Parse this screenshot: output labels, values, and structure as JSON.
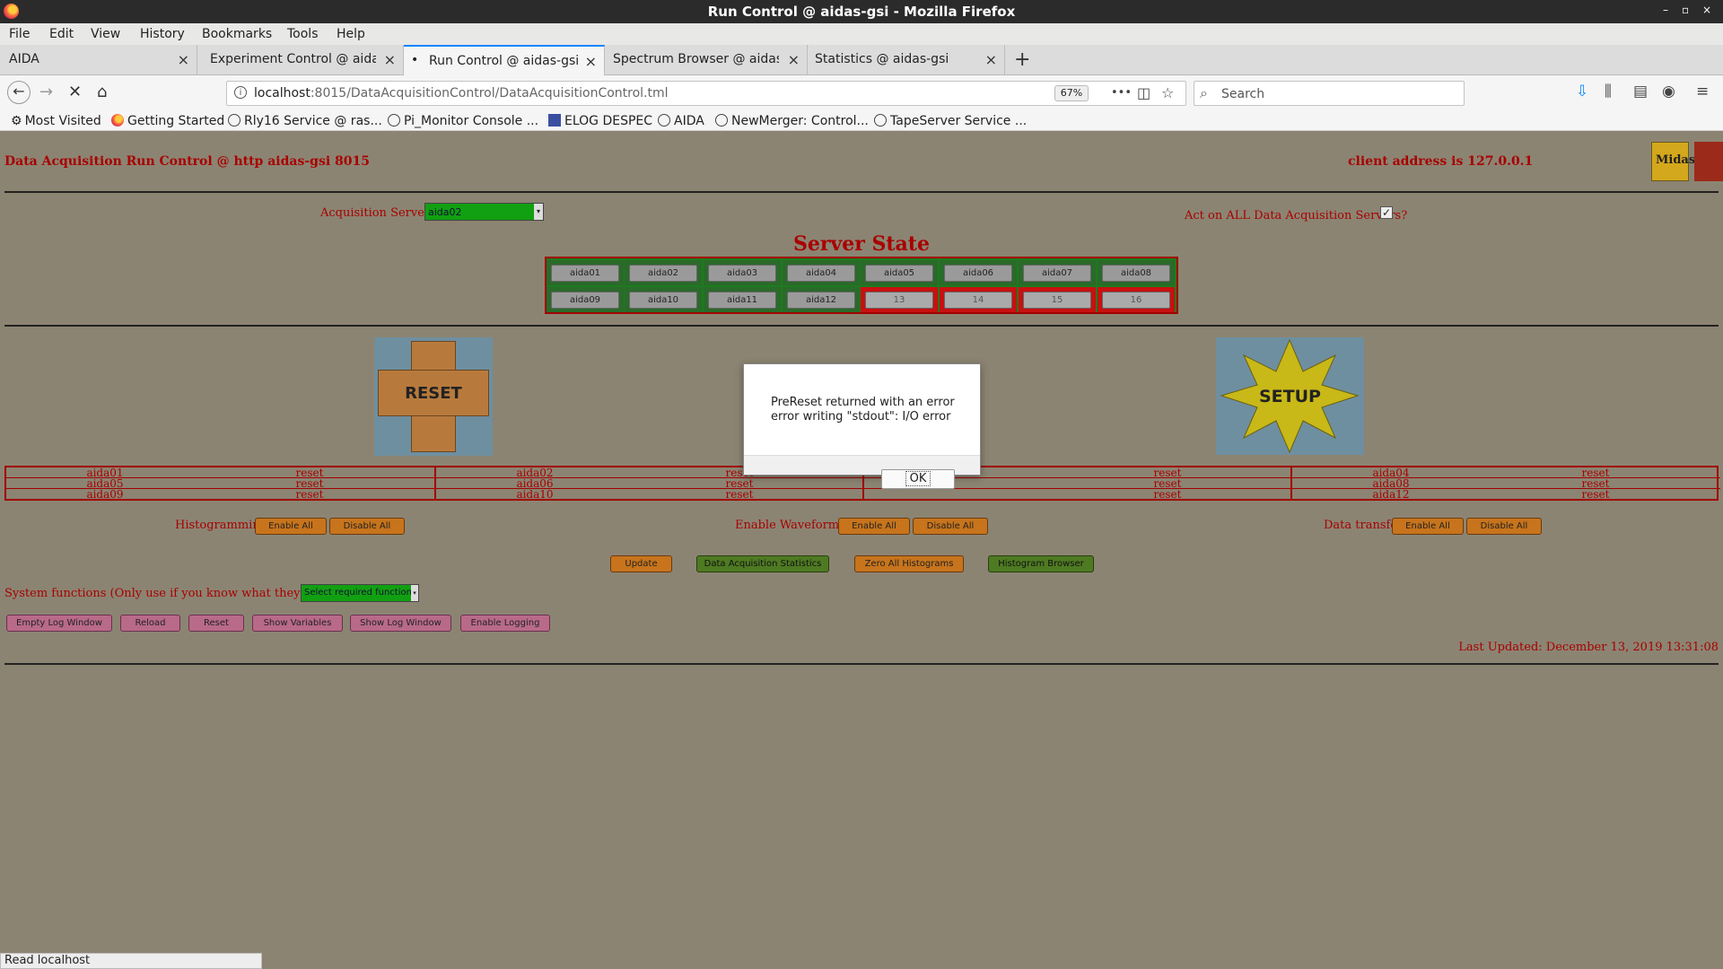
{
  "window": {
    "title": "Run Control @ aidas-gsi - Mozilla Firefox",
    "controls": [
      "–",
      "▫",
      "×"
    ]
  },
  "menubar": [
    "File",
    "Edit",
    "View",
    "History",
    "Bookmarks",
    "Tools",
    "Help"
  ],
  "tabs": [
    {
      "label": "AIDA",
      "active": false
    },
    {
      "label": "Experiment Control @ aidas-",
      "active": false
    },
    {
      "label": "Run Control @ aidas-gsi",
      "active": true
    },
    {
      "label": "Spectrum Browser @ aidas-g",
      "active": false
    },
    {
      "label": "Statistics @ aidas-gsi",
      "active": false
    }
  ],
  "navbar": {
    "url_host": "localhost",
    "url_rest": ":8015/DataAcquisitionControl/DataAcquisitionControl.tml",
    "zoom": "67%",
    "more": "•••",
    "search_placeholder": "Search"
  },
  "bookmarks": [
    {
      "label": "Most Visited",
      "icon": "gear-icon"
    },
    {
      "label": "Getting Started",
      "icon": "firefox-icon"
    },
    {
      "label": "Rly16 Service @ ras...",
      "icon": "globe-icon"
    },
    {
      "label": "Pi_Monitor Console ...",
      "icon": "globe-icon"
    },
    {
      "label": "ELOG DESPEC",
      "icon": "elog-icon"
    },
    {
      "label": "AIDA",
      "icon": "globe-icon"
    },
    {
      "label": "NewMerger: Control...",
      "icon": "globe-icon"
    },
    {
      "label": "TapeServer Service ...",
      "icon": "globe-icon"
    }
  ],
  "page": {
    "heading": "Data Acquisition Run Control @ http aidas-gsi 8015",
    "client_address": "client address is 127.0.0.1",
    "logo_text": "Midas",
    "acquisition_servers_label": "Acquisition Servers",
    "acquisition_server_selected": "aida02",
    "act_on_all_label": "Act on ALL Data Acquisition Servers?",
    "act_on_all_checked": true,
    "server_state_title": "Server State",
    "servers": [
      {
        "label": "aida01",
        "state": "ok"
      },
      {
        "label": "aida02",
        "state": "ok"
      },
      {
        "label": "aida03",
        "state": "ok"
      },
      {
        "label": "aida04",
        "state": "ok"
      },
      {
        "label": "aida05",
        "state": "ok"
      },
      {
        "label": "aida06",
        "state": "ok"
      },
      {
        "label": "aida07",
        "state": "ok"
      },
      {
        "label": "aida08",
        "state": "ok"
      },
      {
        "label": "aida09",
        "state": "ok"
      },
      {
        "label": "aida10",
        "state": "ok"
      },
      {
        "label": "aida11",
        "state": "ok"
      },
      {
        "label": "aida12",
        "state": "ok"
      },
      {
        "label": "13",
        "state": "bad"
      },
      {
        "label": "14",
        "state": "bad"
      },
      {
        "label": "15",
        "state": "bad"
      },
      {
        "label": "16",
        "state": "bad"
      }
    ],
    "reset_button_label": "RESET",
    "setup_button_label": "SETUP",
    "reset_table": [
      [
        {
          "name": "aida01",
          "status": "reset"
        },
        {
          "name": "aida05",
          "status": "reset"
        },
        {
          "name": "aida09",
          "status": "reset"
        }
      ],
      [
        {
          "name": "aida02",
          "status": "reset"
        },
        {
          "name": "aida06",
          "status": "reset"
        },
        {
          "name": "aida10",
          "status": "reset"
        }
      ],
      [
        {
          "name": "",
          "status": "reset"
        },
        {
          "name": "",
          "status": "reset"
        },
        {
          "name": "",
          "status": "reset"
        }
      ],
      [
        {
          "name": "aida04",
          "status": "reset"
        },
        {
          "name": "aida08",
          "status": "reset"
        },
        {
          "name": "aida12",
          "status": "reset"
        }
      ]
    ],
    "histogramming_label": "Histogramming",
    "waveforms_label": "Enable Waveforms",
    "data_transfer_label": "Data transfer",
    "enable_all": "Enable All",
    "disable_all": "Disable All",
    "update": "Update",
    "data_acquisition_statistics": "Data Acquisition Statistics",
    "zero_all_histograms": "Zero All Histograms",
    "histogram_browser": "Histogram Browser",
    "system_functions_label": "System functions (Only use if you know what they do!!!)",
    "system_function_selected": "Select required function",
    "system_buttons": [
      "Empty Log Window",
      "Reload",
      "Reset",
      "Show Variables",
      "Show Log Window",
      "Enable Logging"
    ],
    "last_updated": "Last Updated: December 13, 2019 13:31:08"
  },
  "dialog": {
    "line1": "PreReset returned with an error",
    "line2": "error writing \"stdout\": I/O error",
    "ok": "OK"
  },
  "statusbar": "Read localhost",
  "colors": {
    "page_bg": "#8c8472",
    "text_red": "#a80000",
    "server_ok": "#2a6a2a",
    "server_bad": "#c81010",
    "select_green": "#11a011",
    "button_orange": "#c7741c",
    "button_green": "#4e7a22",
    "button_pink": "#b86a88"
  }
}
